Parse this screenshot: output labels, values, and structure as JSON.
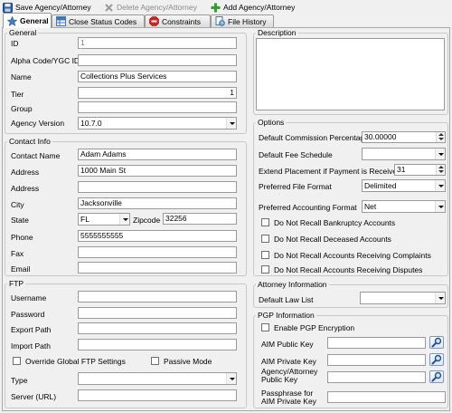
{
  "toolbar": {
    "save_label": "Save Agency/Attorney",
    "delete_label": "Delete Agency/Attorney",
    "add_label": "Add Agency/Attorney"
  },
  "tabs": [
    {
      "label": "General",
      "icon": "star-icon",
      "active": true
    },
    {
      "label": "Close Status Codes",
      "icon": "grid-icon",
      "active": false
    },
    {
      "label": "Constraints",
      "icon": "stop-sign-icon",
      "active": false
    },
    {
      "label": "File History",
      "icon": "file-history-icon",
      "active": false
    }
  ],
  "general": {
    "group_label": "General",
    "id_label": "ID",
    "id_value": "1",
    "alpha_label": "Alpha Code/YGC ID",
    "alpha_value": "",
    "name_label": "Name",
    "name_value": "Collections Plus Services",
    "tier_label": "Tier",
    "tier_value": "1",
    "group_field_label": "Group",
    "group_value": "",
    "version_label": "Agency Version",
    "version_value": "10.7.0"
  },
  "contact": {
    "group_label": "Contact Info",
    "contact_name_label": "Contact Name",
    "contact_name_value": "Adam Adams",
    "address1_label": "Address",
    "address1_value": "1000 Main St",
    "address2_label": "Address",
    "address2_value": "",
    "city_label": "City",
    "city_value": "Jacksonville",
    "state_label": "State",
    "state_value": "FL",
    "zip_label": "Zipcode",
    "zip_value": "32256",
    "phone_label": "Phone",
    "phone_value": "5555555555",
    "fax_label": "Fax",
    "fax_value": "",
    "email_label": "Email",
    "email_value": ""
  },
  "ftp": {
    "group_label": "FTP",
    "username_label": "Username",
    "username_value": "",
    "password_label": "Password",
    "password_value": "",
    "export_label": "Export Path",
    "export_value": "",
    "import_label": "Import Path",
    "import_value": "",
    "override_label": "Override Global FTP Settings",
    "passive_label": "Passive Mode",
    "type_label": "Type",
    "type_value": "",
    "server_label": "Server (URL)",
    "server_value": ""
  },
  "description": {
    "group_label": "Description",
    "value": ""
  },
  "options": {
    "group_label": "Options",
    "commission_label": "Default Commission Percentage",
    "commission_value": "30.00000",
    "fee_label": "Default Fee Schedule",
    "fee_value": "",
    "extend_label": "Extend Placement if Payment is Received",
    "extend_value": "31",
    "file_format_label": "Preferred File Format",
    "file_format_value": "Delimited",
    "acct_format_label": "Preferred Accounting Format",
    "acct_format_value": "Net",
    "checks": [
      "Do Not Recall Bankruptcy Accounts",
      "Do Not Recall Deceased Accounts",
      "Do Not Recall Accounts Receiving Complaints",
      "Do Not Recall Accounts Receiving Disputes"
    ]
  },
  "attorney": {
    "group_label": "Attorney Information",
    "law_list_label": "Default Law List",
    "law_list_value": ""
  },
  "pgp": {
    "group_label": "PGP Information",
    "enable_label": "Enable PGP Encryption",
    "public_label": "AIM Public Key",
    "private_label": "AIM Private Key",
    "agency_key_label": "Agency/Attorney Public Key",
    "passphrase_label": "Passphrase for AIM Private Key"
  }
}
